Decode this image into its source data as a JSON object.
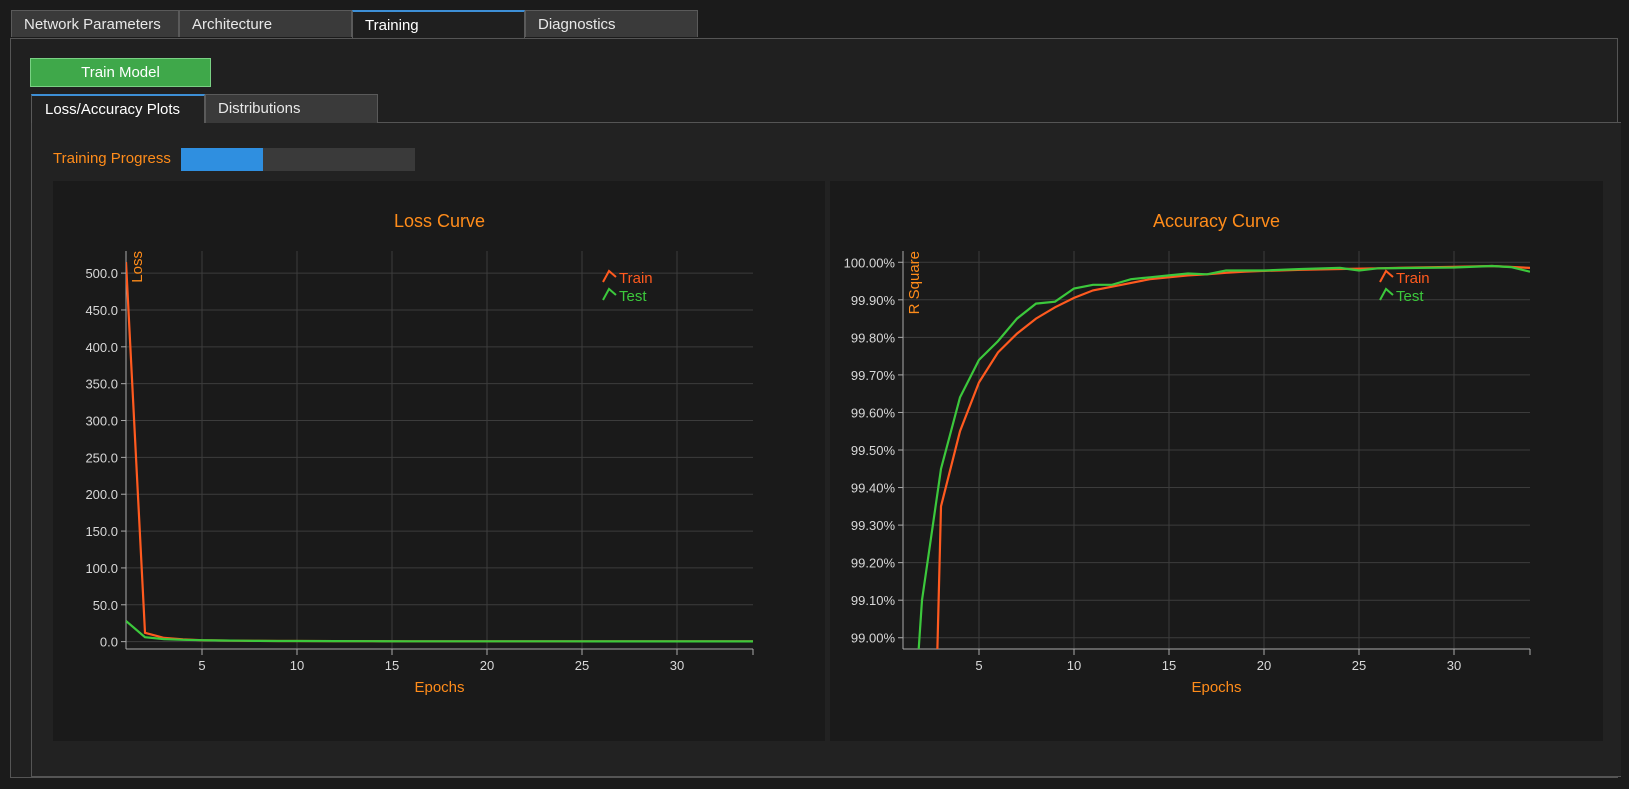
{
  "tabs": [
    "Network Parameters",
    "Architecture",
    "Training",
    "Diagnostics"
  ],
  "active_tab": "Training",
  "train_button": "Train Model",
  "subtabs": [
    "Loss/Accuracy Plots",
    "Distributions"
  ],
  "progress": {
    "label": "Training Progress",
    "value": 0.35
  },
  "colors": {
    "accent_orange": "#ff8c1a",
    "train": "#ff5a1f",
    "test": "#3cc83c",
    "progress": "#2f8fe0",
    "button": "#3fa84a"
  },
  "chart_data": [
    {
      "type": "line",
      "title": "Loss Curve",
      "xlabel": "Epochs",
      "ylabel": "Loss",
      "xlim": [
        1,
        34
      ],
      "ylim": [
        -10,
        530
      ],
      "xticks": [
        5,
        10,
        15,
        20,
        25,
        30
      ],
      "yticks": [
        0,
        50,
        100,
        150,
        200,
        250,
        300,
        350,
        400,
        450,
        500
      ],
      "ytick_labels": [
        "0.0",
        "50.0",
        "100.0",
        "150.0",
        "200.0",
        "250.0",
        "300.0",
        "350.0",
        "400.0",
        "450.0",
        "500.0"
      ],
      "legend": "top-right",
      "series": [
        {
          "name": "Train",
          "x": [
            1,
            2,
            3,
            4,
            5,
            6,
            7,
            8,
            9,
            10,
            12,
            14,
            16,
            18,
            20,
            22,
            24,
            26,
            28,
            30,
            32,
            34
          ],
          "values": [
            515,
            12,
            5,
            3,
            2,
            1.5,
            1.2,
            1,
            0.9,
            0.8,
            0.7,
            0.6,
            0.5,
            0.5,
            0.4,
            0.4,
            0.4,
            0.3,
            0.3,
            0.3,
            0.3,
            0.3
          ]
        },
        {
          "name": "Test",
          "x": [
            1,
            2,
            3,
            4,
            5,
            6,
            7,
            8,
            9,
            10,
            12,
            14,
            16,
            18,
            20,
            22,
            24,
            26,
            28,
            30,
            32,
            34
          ],
          "values": [
            28,
            6,
            3.5,
            2.5,
            2,
            1.5,
            1.2,
            1,
            0.9,
            0.8,
            0.7,
            0.6,
            0.5,
            0.5,
            0.4,
            0.4,
            0.4,
            0.3,
            0.3,
            0.3,
            0.3,
            0.3
          ]
        }
      ]
    },
    {
      "type": "line",
      "title": "Accuracy Curve",
      "xlabel": "Epochs",
      "ylabel": "R Square",
      "xlim": [
        1,
        34
      ],
      "ylim": [
        98.97,
        100.03
      ],
      "xticks": [
        5,
        10,
        15,
        20,
        25,
        30
      ],
      "yticks": [
        99.0,
        99.1,
        99.2,
        99.3,
        99.4,
        99.5,
        99.6,
        99.7,
        99.8,
        99.9,
        100.0
      ],
      "ytick_labels": [
        "99.00%",
        "99.10%",
        "99.20%",
        "99.30%",
        "99.40%",
        "99.50%",
        "99.60%",
        "99.70%",
        "99.80%",
        "99.90%",
        "100.00%"
      ],
      "legend": "top-right",
      "series": [
        {
          "name": "Train",
          "x": [
            2.8,
            3,
            4,
            5,
            6,
            7,
            8,
            9,
            10,
            11,
            12,
            13,
            14,
            15,
            16,
            17,
            18,
            19,
            20,
            22,
            24,
            26,
            28,
            30,
            32,
            34
          ],
          "values": [
            98.95,
            99.35,
            99.55,
            99.68,
            99.76,
            99.81,
            99.85,
            99.88,
            99.905,
            99.925,
            99.935,
            99.945,
            99.955,
            99.96,
            99.965,
            99.968,
            99.972,
            99.975,
            99.977,
            99.98,
            99.982,
            99.984,
            99.986,
            99.988,
            99.99,
            99.985
          ]
        },
        {
          "name": "Test",
          "x": [
            1.8,
            2,
            3,
            4,
            5,
            6,
            7,
            8,
            9,
            10,
            11,
            12,
            13,
            14,
            15,
            16,
            17,
            18,
            19,
            20,
            22,
            24,
            25,
            26,
            28,
            30,
            32,
            33,
            34
          ],
          "values": [
            98.95,
            99.1,
            99.45,
            99.64,
            99.74,
            99.79,
            99.85,
            99.89,
            99.895,
            99.93,
            99.94,
            99.94,
            99.955,
            99.96,
            99.965,
            99.97,
            99.968,
            99.978,
            99.978,
            99.978,
            99.982,
            99.985,
            99.978,
            99.984,
            99.985,
            99.986,
            99.99,
            99.987,
            99.975
          ]
        }
      ]
    }
  ]
}
